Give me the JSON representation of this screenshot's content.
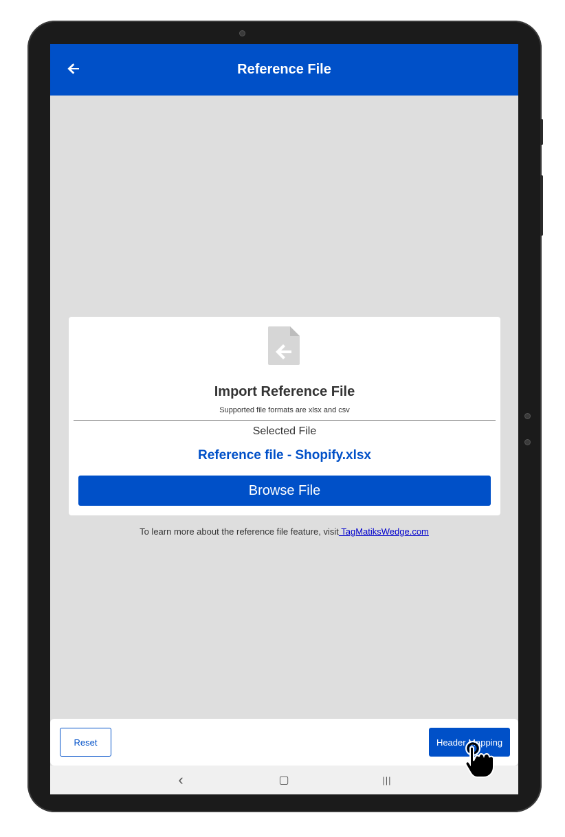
{
  "appbar": {
    "title": "Reference File",
    "back_icon": "arrow-left-icon"
  },
  "card": {
    "icon": "file-import-icon",
    "title": "Import Reference File",
    "subtitle": "Supported file formats are xlsx and csv",
    "selected_label": "Selected File",
    "selected_file": "Reference file - Shopify.xlsx",
    "browse_label": "Browse File"
  },
  "info": {
    "text": "To learn more about the reference file feature, visit",
    "link": " TagMatiksWedge.com"
  },
  "footer": {
    "reset_label": "Reset",
    "header_mapping_label": "Header Mapping"
  },
  "navbar": {
    "back": "‹",
    "home": "▢",
    "recents": "|||"
  },
  "colors": {
    "primary": "#0050c8",
    "background": "#dedede",
    "text": "#333333"
  }
}
